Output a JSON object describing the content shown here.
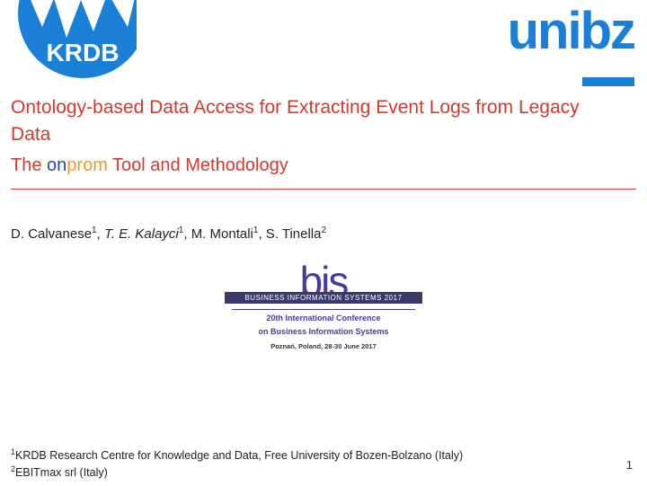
{
  "logos": {
    "krdb_label": "KRDB",
    "unibz_label": "unibz"
  },
  "title": {
    "line1": "Ontology-based Data Access for Extracting Event Logs from Legacy",
    "line2": "Data",
    "subtitle_prefix": "The ",
    "onprom_on": "on",
    "onprom_prom": "prom",
    "subtitle_suffix": " Tool and Methodology"
  },
  "authors": {
    "a1_name": "D. Calvanese",
    "a1_aff": "1",
    "sep1": ", ",
    "a2_name": "T. E. Kalayci",
    "a2_aff": "1",
    "sep2": ", ",
    "a3_name": "M. Montali",
    "a3_aff": "1",
    "sep3": ", ",
    "a4_name": "S. Tinella",
    "a4_aff": "2"
  },
  "conference": {
    "bis": "bis",
    "banner": "BUSINESS INFORMATION SYSTEMS 2017",
    "sub1": "20th International Conference",
    "sub2": "on Business Information Systems",
    "location": "Poznań, Poland, 28-30 June 2017"
  },
  "affiliations": {
    "aff1_num": "1",
    "aff1_text": "KRDB Research Centre for Knowledge and Data, Free University of Bozen-Bolzano (Italy)",
    "aff2_num": "2",
    "aff2_text": "EBITmax srl (Italy)"
  },
  "page_number": "1"
}
